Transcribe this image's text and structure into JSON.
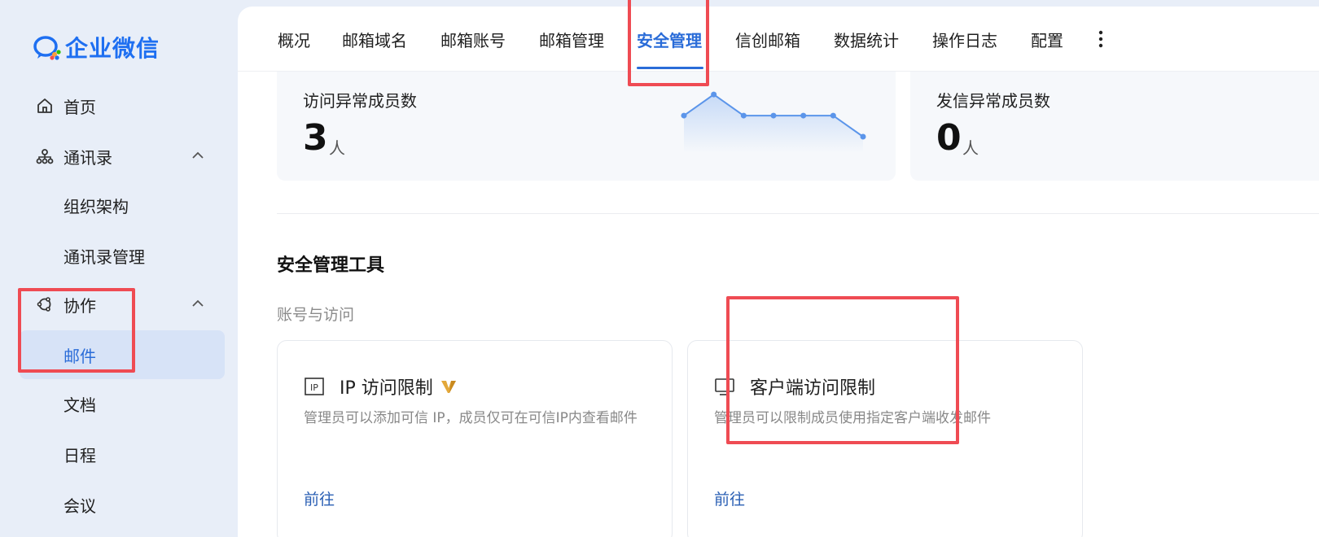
{
  "app": {
    "name": "企业微信"
  },
  "sidebar": {
    "items": [
      {
        "label": "首页",
        "icon": "home-icon"
      },
      {
        "label": "通讯录",
        "icon": "org-icon",
        "expanded": true
      },
      {
        "label": "组织架构"
      },
      {
        "label": "通讯录管理"
      },
      {
        "label": "协作",
        "icon": "collab-icon",
        "expanded": true
      },
      {
        "label": "邮件",
        "active": true
      },
      {
        "label": "文档"
      },
      {
        "label": "日程"
      },
      {
        "label": "会议"
      }
    ]
  },
  "tabs": [
    {
      "label": "概况"
    },
    {
      "label": "邮箱域名"
    },
    {
      "label": "邮箱账号"
    },
    {
      "label": "邮箱管理"
    },
    {
      "label": "安全管理",
      "active": true
    },
    {
      "label": "信创邮箱"
    },
    {
      "label": "数据统计"
    },
    {
      "label": "操作日志"
    },
    {
      "label": "配置"
    }
  ],
  "stats": [
    {
      "title": "访问异常成员数",
      "value": "3",
      "unit": "人"
    },
    {
      "title": "发信异常成员数",
      "value": "0",
      "unit": "人"
    }
  ],
  "chart_data": {
    "type": "line",
    "series": [
      {
        "values": [
          2,
          3,
          2,
          2,
          2,
          2,
          1
        ]
      }
    ]
  },
  "section": {
    "title": "安全管理工具",
    "subsection": "账号与访问"
  },
  "tools": [
    {
      "name": "IP 访问限制",
      "icon": "ip-icon",
      "badge_icon": "vip-badge-icon",
      "description": "管理员可以添加可信 IP，成员仅可在可信IP内查看邮件",
      "link": "前往"
    },
    {
      "name": "客户端访问限制",
      "icon": "monitor-icon",
      "description": "管理员可以限制成员使用指定客户端收发邮件",
      "link": "前往"
    }
  ],
  "colors": {
    "accent": "#2a6cd8",
    "highlight": "#ef4b53",
    "sidebar_bg": "#e8eef8"
  }
}
